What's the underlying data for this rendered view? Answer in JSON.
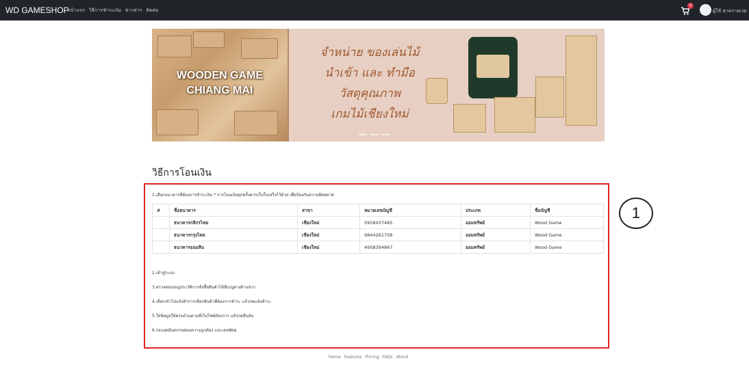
{
  "navbar": {
    "brand": "WD GAMESHOP",
    "links": [
      "หน้าแรก",
      "วิธีการชำระเงิน",
      "ข่าวสาร",
      "ติดต่อ"
    ],
    "cart_count": "0",
    "username": "ผู้ใช้ ฮาครายเรย"
  },
  "banner": {
    "left_title_line1": "WOODEN GAME",
    "left_title_line2": "CHIANG MAI",
    "thai_lines": [
      "จำหน่าย ของเล่นไม้",
      "นำเข้า และ ทำมือ",
      "วัสดุคุณภาพ",
      "เกมไม้เชียงใหม่"
    ]
  },
  "page_title": "วิธีการโอนเงิน",
  "intro": "1.เลือกธนาคารที่ต้องการชำระเงิน * การโอนเงินทุกครั้งควรเก็บใบเสร็จไว้ด้วย เพื่อป้องกันความผิดพลาด",
  "table": {
    "headers": [
      "#",
      "ชื่อธนาคาร",
      "สาขา",
      "หมายเลขบัญชี",
      "ประเภท",
      "ชื่อบัญชี"
    ],
    "rows": [
      [
        "",
        "ธนาคารกสิกรไทย",
        "เชียงใหม่",
        "5958437485",
        "ออมทรัพย์",
        "Wood Game"
      ],
      [
        "",
        "ธนาคารกรุงไทย",
        "เชียงใหม่",
        "9844261708",
        "ออมทรัพย์",
        "Wood Game"
      ],
      [
        "",
        "ธนาคารออมสิน",
        "เชียงใหม่",
        "4958394867",
        "ออมทรัพย์",
        "Wood Game"
      ]
    ]
  },
  "steps": [
    "2.เข้าสู่ระบบ",
    "3.ตรวจสอบเมนูประวัติการสั่งซื้อสินค้าได้ที่เมนูทางด้านขวา",
    "4.เลือกเข้าไปแจ้งทำการเลือกสินค้าที่ต้องการชำระ แล้วกดแจ้งชำระ",
    "5.ใส่ข้อมูลให้ครบถ้วนตามที่เว็บไซต์ต้องการ แล้วกดยืนยัน",
    "6.รอแอดมินตรวจสอบความถูกต้อง และเลขพัสดุ"
  ],
  "annotation": "1",
  "footer": [
    "Home",
    "Features",
    "Pricing",
    "FAQs",
    "About"
  ],
  "colors": {
    "navbar": "#212529",
    "annotation_border": "#e02020",
    "banner_text": "#a0592f"
  }
}
